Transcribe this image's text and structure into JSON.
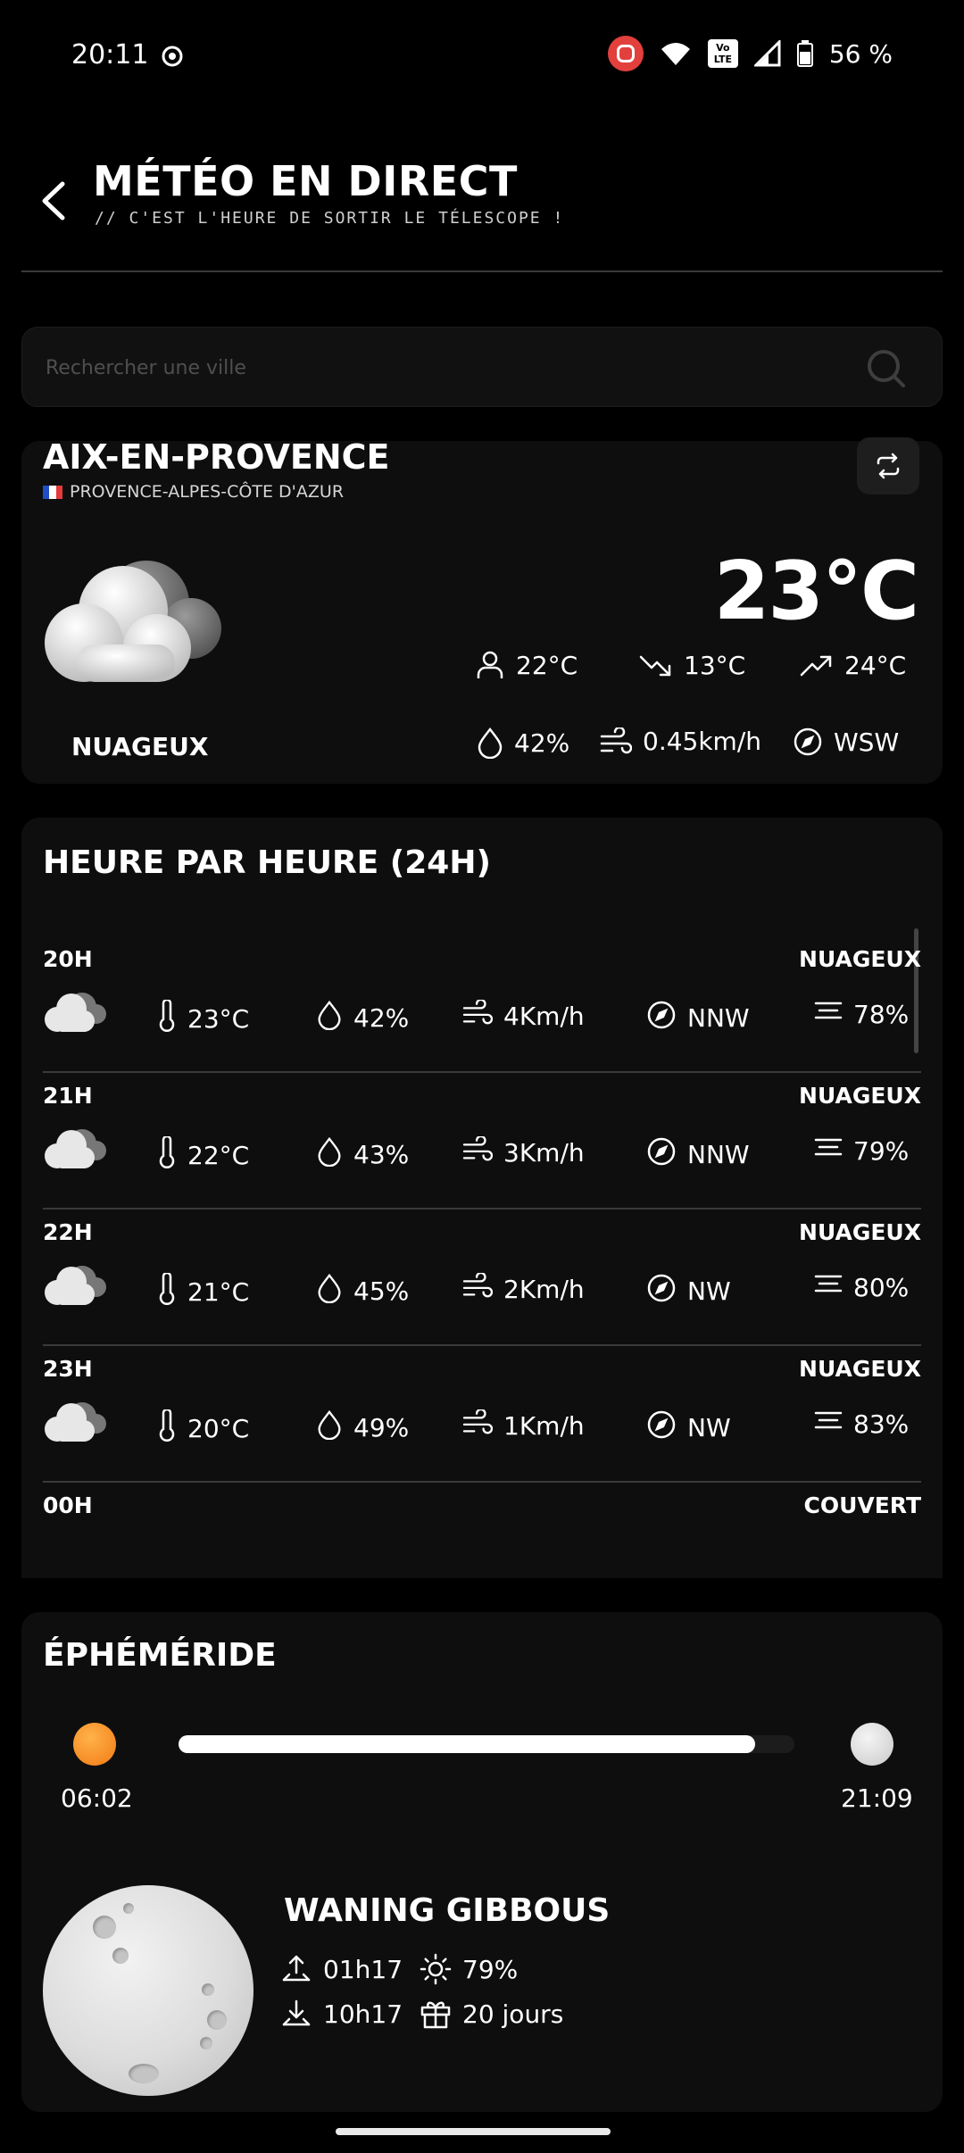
{
  "status_bar": {
    "time": "20:11",
    "battery": "56 %",
    "lte_label": "Vo\nLTE"
  },
  "header": {
    "title": "MÉTÉO EN DIRECT",
    "subtitle": "// C'EST L'HEURE DE SORTIR LE TÉLESCOPE !"
  },
  "search": {
    "placeholder": "Rechercher une ville"
  },
  "current": {
    "city": "AIX-EN-PROVENCE",
    "region": "PROVENCE-ALPES-CÔTE D'AZUR",
    "temperature": "23°C",
    "condition": "NUAGEUX",
    "feels_like": "22°C",
    "min": "13°C",
    "max": "24°C",
    "humidity": "42%",
    "wind": "0.45km/h",
    "direction": "WSW"
  },
  "hourly": {
    "title": "HEURE PAR HEURE (24H)",
    "rows": [
      {
        "hour": "20H",
        "condition": "NUAGEUX",
        "temp": "23°C",
        "humidity": "42%",
        "wind": "4Km/h",
        "direction": "NNW",
        "cloud": "78%"
      },
      {
        "hour": "21H",
        "condition": "NUAGEUX",
        "temp": "22°C",
        "humidity": "43%",
        "wind": "3Km/h",
        "direction": "NNW",
        "cloud": "79%"
      },
      {
        "hour": "22H",
        "condition": "NUAGEUX",
        "temp": "21°C",
        "humidity": "45%",
        "wind": "2Km/h",
        "direction": "NW",
        "cloud": "80%"
      },
      {
        "hour": "23H",
        "condition": "NUAGEUX",
        "temp": "20°C",
        "humidity": "49%",
        "wind": "1Km/h",
        "direction": "NW",
        "cloud": "83%"
      },
      {
        "hour": "00H",
        "condition": "COUVERT"
      }
    ]
  },
  "ephemeris": {
    "title": "ÉPHÉMÉRIDE",
    "sunrise": "06:02",
    "sunset": "21:09",
    "moon_phase": "WANING GIBBOUS",
    "moonrise": "01h17",
    "moonset": "10h17",
    "illumination": "79%",
    "age": "20 jours"
  },
  "icons": [
    "back-arrow-icon",
    "search-icon",
    "swap-icon",
    "person-icon",
    "trend-down-icon",
    "trend-up-icon",
    "drop-icon",
    "wind-icon",
    "compass-icon",
    "thermometer-icon",
    "cloud-layers-icon",
    "cloud-icon",
    "moonrise-icon",
    "moonset-icon",
    "sun-icon",
    "gift-icon"
  ]
}
